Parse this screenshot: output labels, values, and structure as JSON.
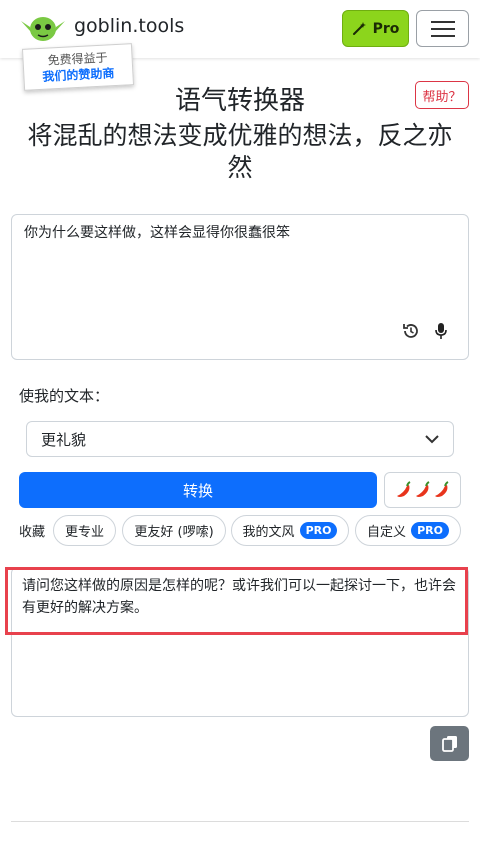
{
  "header": {
    "brand": "goblin.tools",
    "pro_label": "Pro",
    "menu_icon": "hamburger-icon",
    "logo": "goblin-logo",
    "colors": {
      "pro_green": "#8cd51c",
      "accent_blue": "#0d6efd",
      "danger_red": "#dc3545"
    }
  },
  "sponsor": {
    "line1": "免费得益于",
    "line2": "我们的赞助商"
  },
  "help_label": "帮助？",
  "page": {
    "title": "语气转换器",
    "subtitle": "将混乱的想法变成优雅的想法，反之亦然"
  },
  "input": {
    "text": "你为什么要这样做，这样会显得你很蠢很笨",
    "icons": [
      "history-icon",
      "microphone-icon"
    ]
  },
  "make_label": "使我的文本：",
  "tone_select": {
    "selected": "更礼貌"
  },
  "convert_label": "转换",
  "spice": {
    "icon": "chili-pepper-icon",
    "count": 3
  },
  "favorites": {
    "label": "收藏",
    "chips": [
      {
        "label": "更专业"
      },
      {
        "label": "更友好 (啰嗦)"
      },
      {
        "label": "我的文风",
        "badge": "PRO"
      },
      {
        "label": "自定义",
        "badge": "PRO"
      }
    ]
  },
  "output": {
    "text": "请问您这样做的原因是怎样的呢？或许我们可以一起探讨一下，也许会有更好的解决方案。"
  },
  "copy_icon": "copy-icon"
}
